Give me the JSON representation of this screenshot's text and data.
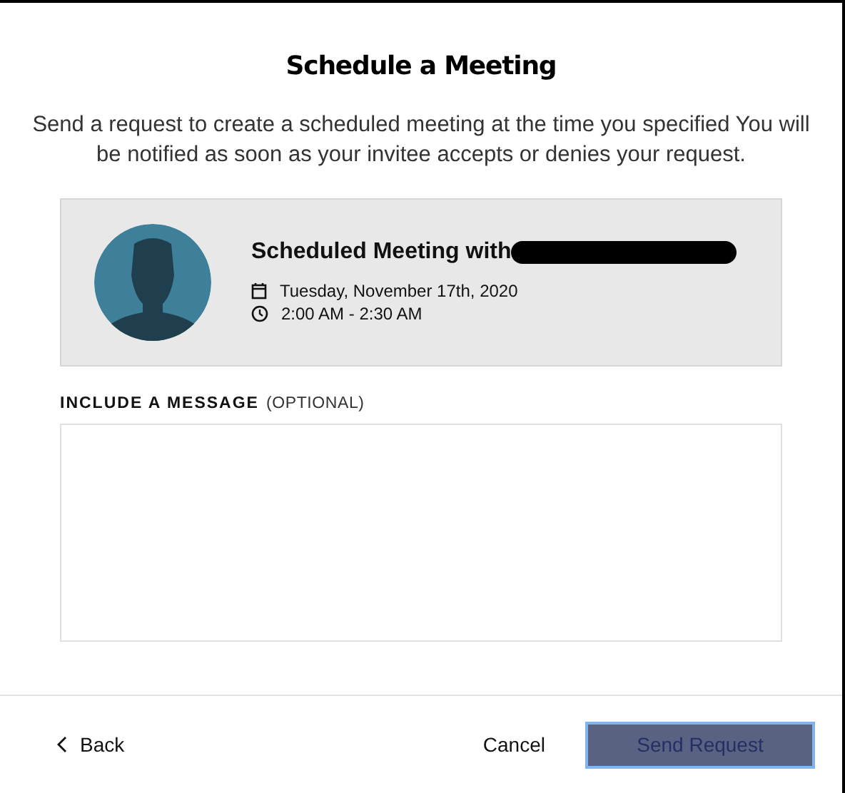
{
  "dialog": {
    "title": "Schedule a Meeting",
    "description": "Send a request to create a scheduled meeting at the time you specified You will be notified as soon as your invitee accepts or denies your request."
  },
  "meeting": {
    "heading": "Scheduled Meeting with",
    "date": "Tuesday, November 17th, 2020",
    "time": "2:00 AM - 2:30 AM"
  },
  "message": {
    "label": "INCLUDE A MESSAGE",
    "hint": "(OPTIONAL)"
  },
  "footer": {
    "back": "Back",
    "cancel": "Cancel",
    "send": {
      "label": "Send Request",
      "disabled": true
    }
  }
}
